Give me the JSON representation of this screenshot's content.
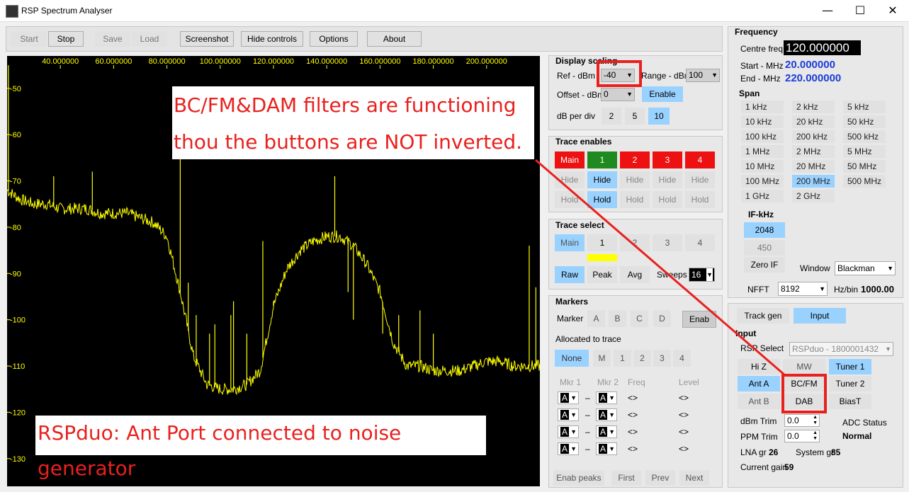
{
  "window": {
    "title": "RSP Spectrum Analyser",
    "min": "—",
    "max": "☐",
    "close": "✕"
  },
  "toolbar": {
    "start": "Start",
    "stop": "Stop",
    "save": "Save",
    "load": "Load",
    "screenshot": "Screenshot",
    "hide": "Hide controls",
    "options": "Options",
    "about": "About"
  },
  "plot": {
    "x_ticks": [
      "40.000000",
      "60.000000",
      "80.000000",
      "100.000000",
      "120.000000",
      "140.000000",
      "160.000000",
      "180.000000",
      "200.000000"
    ],
    "y_ticks": [
      "-50",
      "-60",
      "-70",
      "-80",
      "-90",
      "-100",
      "-110",
      "-120",
      "-130"
    ],
    "trace_color": "#ffff00",
    "tick_color": "#ffff00"
  },
  "chart_data": {
    "type": "line",
    "xlabel": "",
    "ylabel": "",
    "xlim": [
      20,
      220
    ],
    "ylim": [
      -136,
      -43
    ],
    "series": [
      {
        "x": [
          20,
          25,
          30,
          35,
          40,
          45,
          50,
          55,
          60,
          65,
          70,
          75,
          80,
          85,
          90,
          95,
          100,
          105,
          110,
          115,
          120,
          125,
          130,
          135,
          140,
          145,
          150,
          155,
          160,
          165,
          170,
          175,
          180,
          185,
          190,
          195,
          200,
          205,
          210,
          215,
          220
        ],
        "y": [
          -72,
          -74,
          -75,
          -75,
          -76,
          -76,
          -76,
          -77,
          -77,
          -77,
          -78,
          -79,
          -82,
          -94,
          -108,
          -114,
          -115,
          -115,
          -114,
          -111,
          -97,
          -89,
          -85,
          -83,
          -82,
          -82,
          -84,
          -88,
          -94,
          -105,
          -110,
          -110,
          -111,
          -111,
          -111,
          -110,
          -109,
          -109,
          -110,
          -110,
          -110
        ]
      }
    ],
    "spurs": [
      {
        "x": 20.5,
        "y": -45
      },
      {
        "x": 37.5,
        "y": -69
      },
      {
        "x": 52,
        "y": -68
      },
      {
        "x": 85,
        "y": -58
      },
      {
        "x": 88,
        "y": -92
      },
      {
        "x": 91,
        "y": -99
      },
      {
        "x": 96,
        "y": -103
      },
      {
        "x": 98,
        "y": -101
      },
      {
        "x": 104,
        "y": -99
      },
      {
        "x": 105,
        "y": -96
      },
      {
        "x": 110,
        "y": -103
      },
      {
        "x": 116,
        "y": -83
      },
      {
        "x": 120,
        "y": -96
      },
      {
        "x": 143,
        "y": -69
      },
      {
        "x": 148,
        "y": -94
      },
      {
        "x": 150,
        "y": -100
      },
      {
        "x": 161,
        "y": -103
      },
      {
        "x": 167,
        "y": -99
      },
      {
        "x": 175,
        "y": -98
      },
      {
        "x": 180,
        "y": -103
      },
      {
        "x": 216,
        "y": -84
      },
      {
        "x": 218.5,
        "y": -93
      }
    ]
  },
  "display_scaling": {
    "title": "Display scaling",
    "ref_label": "Ref - dBm",
    "ref_value": "-40",
    "range_label": "Range - dBm",
    "range_value": "100",
    "offset_label": "Offset - dBm",
    "offset_value": "0",
    "enable": "Enable",
    "dbdiv_label": "dB per div",
    "d2": "2",
    "d5": "5",
    "d10": "10"
  },
  "trace_enables": {
    "title": "Trace enables",
    "main": "Main",
    "t1": "1",
    "t2": "2",
    "t3": "3",
    "t4": "4",
    "hide": "Hide",
    "hold": "Hold"
  },
  "trace_select": {
    "title": "Trace select",
    "main": "Main",
    "t1": "1",
    "t2": "2",
    "t3": "3",
    "t4": "4",
    "raw": "Raw",
    "peak": "Peak",
    "avg": "Avg",
    "sweeps_label": "Sweeps",
    "sweeps_value": "16"
  },
  "markers": {
    "title": "Markers",
    "marker_label": "Marker",
    "a": "A",
    "b": "B",
    "c": "C",
    "d": "D",
    "enab": "Enab",
    "allocated": "Allocated to trace",
    "none": "None",
    "m": "M",
    "n1": "1",
    "n2": "2",
    "n3": "3",
    "n4": "4",
    "col_mkr1": "Mkr 1",
    "col_mkr2": "Mkr 2",
    "col_freq": "Freq",
    "col_level": "Level",
    "sel_a": "A",
    "dash": "–",
    "ph": "<>",
    "enab_peaks": "Enab peaks",
    "first": "First",
    "prev": "Prev",
    "next": "Next"
  },
  "frequency": {
    "title": "Frequency",
    "centre_label": "Centre freq",
    "centre_value": "120.000000",
    "start_label": "Start - MHz",
    "start_value": "20.000000",
    "end_label": "End - MHz",
    "end_value": "220.000000",
    "span_title": "Span",
    "spans": [
      "1 kHz",
      "2 kHz",
      "5 kHz",
      "10 kHz",
      "20 kHz",
      "50 kHz",
      "100 kHz",
      "200 kHz",
      "500 kHz",
      "1 MHz",
      "2 MHz",
      "5 MHz",
      "10 MHz",
      "20 MHz",
      "50 MHz",
      "100 MHz",
      "200 MHz",
      "500 MHz",
      "1 GHz",
      "2 GHz"
    ],
    "if_title": "IF-kHz",
    "if_2048": "2048",
    "if_450": "450",
    "zero_if": "Zero IF",
    "window_label": "Window",
    "window_value": "Blackman",
    "nfft_label": "NFFT",
    "nfft_value": "8192",
    "hzbin_label": "Hz/bin",
    "hzbin_value": "1000.00"
  },
  "input": {
    "track_gen": "Track gen",
    "input": "Input",
    "title": "Input",
    "rsp_select_label": "RSP Select",
    "rsp_select_value": "RSPduo - 1800001432",
    "hiz": "Hi Z",
    "mw": "MW",
    "tuner1": "Tuner 1",
    "anta": "Ant A",
    "bcfm": "BC/FM",
    "tuner2": "Tuner 2",
    "antb": "Ant B",
    "dab": "DAB",
    "biast": "BiasT",
    "dbm_trim_label": "dBm Trim",
    "dbm_trim_value": "0.0",
    "ppm_trim_label": "PPM Trim",
    "ppm_trim_value": "0.0",
    "adc_label": "ADC Status",
    "adc_value": "Normal",
    "lna_label": "LNA gr",
    "lna_value": "26",
    "sys_label": "System gr",
    "sys_value": "85",
    "cur_label": "Current gain",
    "cur_value": "59"
  },
  "annotations": {
    "filters_line1": "BC/FM&DAM filters are functioning",
    "filters_line2": "thou the buttons are NOT inverted.",
    "rspduo": "RSPduo: Ant Port connected to noise generator",
    "annot_color": "#e8211e"
  }
}
